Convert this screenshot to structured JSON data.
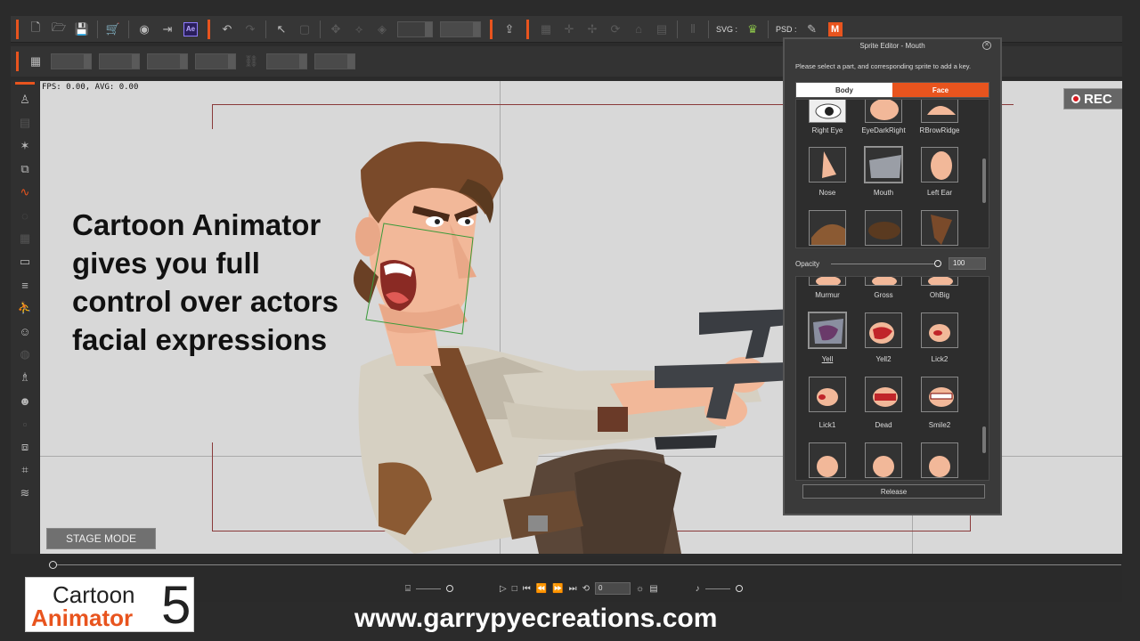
{
  "toolbar": {
    "svg_label": "SVG :",
    "psd_label": "PSD :",
    "ae_label": "Ae",
    "m_label": "M"
  },
  "stage": {
    "fps_text": "FPS: 0.00, AVG: 0.00",
    "caption": "Cartoon Animator gives you full control over actors facial expressions",
    "stage_mode_label": "STAGE MODE",
    "rec_label": "REC"
  },
  "timeline": {
    "frame_value": "0"
  },
  "sprite_editor": {
    "title": "Sprite Editor - Mouth",
    "hint": "Please select a part, and corresponding sprite to add a key.",
    "tabs": {
      "body": "Body",
      "face": "Face"
    },
    "parts_row1": [
      "Right Eye",
      "EyeDarkRight",
      "RBrowRidge"
    ],
    "parts_row2": [
      "Nose",
      "Mouth",
      "Left Ear"
    ],
    "opacity_label": "Opacity",
    "opacity_value": "100",
    "sprites_row0": [
      "Murmur",
      "Gross",
      "OhBig"
    ],
    "sprites_row1": [
      "Yell",
      "Yell2",
      "Lick2"
    ],
    "sprites_row2": [
      "Lick1",
      "Dead",
      "Smile2"
    ],
    "release_label": "Release"
  },
  "branding": {
    "logo_line1": "Cartoon",
    "logo_line2": "Animator",
    "logo_number": "5",
    "website": "www.garrypyecreations.com"
  },
  "colors": {
    "accent": "#e8541e",
    "stage_bg": "#d8d8d8",
    "panel_bg": "#3a3a3a"
  }
}
